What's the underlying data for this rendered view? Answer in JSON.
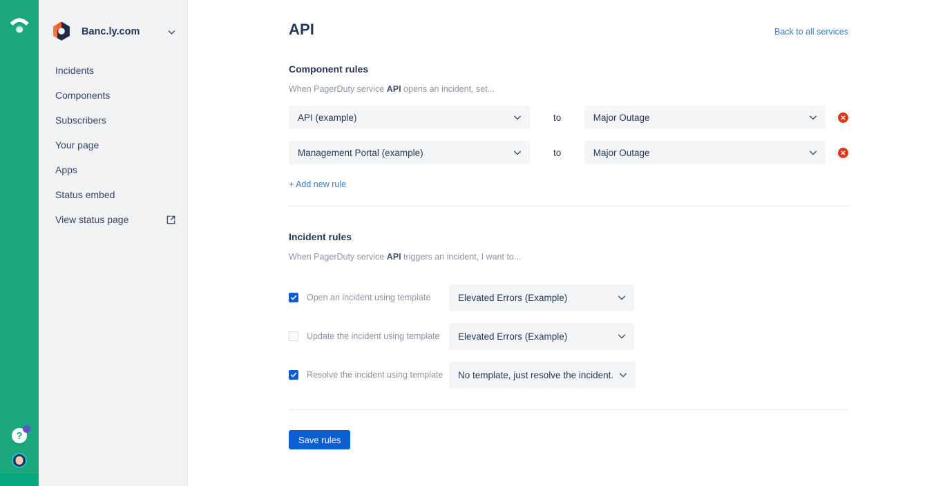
{
  "rail": {
    "logo_icon": "statuspage-signal-icon",
    "help_icon": "help-question-icon",
    "help_badge_color": "#6554C0",
    "avatar_icon": "user-avatar",
    "background_color": "#1CA87C"
  },
  "sidebar": {
    "org": {
      "name": "Banc.ly.com",
      "logo_icon": "pagerduty-hex-logo",
      "chevron_icon": "chevron-down-icon"
    },
    "items": [
      {
        "label": "Incidents",
        "icon": ""
      },
      {
        "label": "Components",
        "icon": ""
      },
      {
        "label": "Subscribers",
        "icon": ""
      },
      {
        "label": "Your page",
        "icon": ""
      },
      {
        "label": "Apps",
        "icon": ""
      },
      {
        "label": "Status embed",
        "icon": ""
      },
      {
        "label": "View status page",
        "icon": "external-link-icon"
      }
    ]
  },
  "main": {
    "title": "API",
    "back_link": "Back to all services",
    "component_rules": {
      "heading": "Component rules",
      "subtitle_prefix": "When PagerDuty service ",
      "subtitle_service": "API",
      "subtitle_suffix": " opens an incident, set...",
      "to_label": "to",
      "delete_icon": "close-x-icon",
      "chevron_icon": "chevron-down-icon",
      "rows": [
        {
          "component": "API (example)",
          "status": "Major Outage"
        },
        {
          "component": "Management Portal (example)",
          "status": "Major Outage"
        }
      ],
      "add_rule_label": "+ Add new rule"
    },
    "incident_rules": {
      "heading": "Incident rules",
      "subtitle_prefix": "When PagerDuty service ",
      "subtitle_service": "API",
      "subtitle_suffix": " triggers an incident, I want to...",
      "chevron_icon": "chevron-down-icon",
      "rows": [
        {
          "label": "Open an incident using template",
          "checked": true,
          "template": "Elevated Errors (Example)"
        },
        {
          "label": "Update the incident using template",
          "checked": false,
          "template": "Elevated Errors (Example)"
        },
        {
          "label": "Resolve the incident using template",
          "checked": true,
          "template": "No template, just resolve the incident."
        }
      ]
    },
    "save_label": "Save rules"
  },
  "colors": {
    "rail_green": "#1CA87C",
    "sidebar_grey": "#F1F2F4",
    "link_blue": "#2F7DD1",
    "primary_blue": "#0B5FCE",
    "danger_red": "#DE3618",
    "field_grey": "#F4F5F7",
    "text_dark": "#253858",
    "text_muted": "#8A94A6"
  }
}
